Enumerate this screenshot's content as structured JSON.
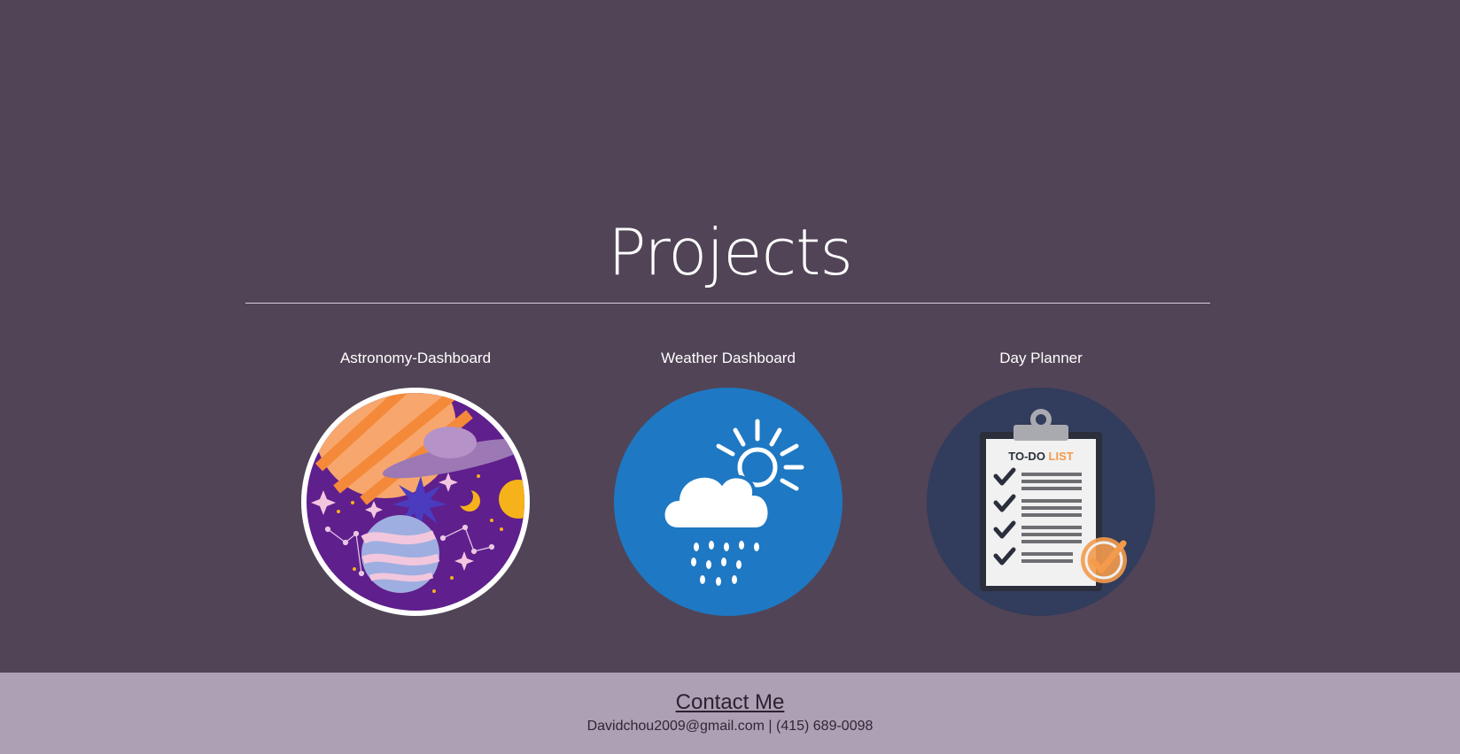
{
  "header": {
    "title": "Projects"
  },
  "projects": [
    {
      "title": "Astronomy-Dashboard",
      "icon": "astronomy-illustration-icon",
      "accent": "#5f1f8c"
    },
    {
      "title": "Weather Dashboard",
      "icon": "cloud-sun-rain-icon",
      "accent": "#1e78c3"
    },
    {
      "title": "Day Planner",
      "icon": "todo-clipboard-icon",
      "accent": "#323c5c"
    }
  ],
  "footer": {
    "contact_title": "Contact Me",
    "email": "Davidchou2009@gmail.com",
    "separator": " | ",
    "phone": "(415) 689-0098"
  },
  "colors": {
    "background": "#514456",
    "footer": "#ad9fb4",
    "text": "#ffffff"
  }
}
